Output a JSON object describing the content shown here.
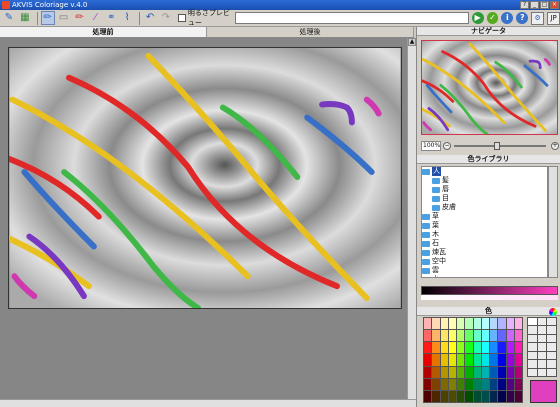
{
  "window": {
    "title": "AKVIS Coloriage v.4.0",
    "buttons": [
      "?",
      "_",
      "□",
      "×"
    ]
  },
  "toolbar": {
    "preview_label": "明るさプレビュー",
    "preview_checked": false,
    "url_value": "",
    "lang": "JP"
  },
  "tabs": [
    {
      "label": "処理前",
      "active": true
    },
    {
      "label": "処理後",
      "active": false
    }
  ],
  "navigator": {
    "title": "ナビゲータ",
    "zoom": "100%"
  },
  "library": {
    "title": "色ライブラリ",
    "items": [
      {
        "label": "人",
        "sub": false,
        "selected": true
      },
      {
        "label": "髪",
        "sub": true
      },
      {
        "label": "唇",
        "sub": true
      },
      {
        "label": "目",
        "sub": true
      },
      {
        "label": "皮膚",
        "sub": true
      },
      {
        "label": "草",
        "sub": false
      },
      {
        "label": "葉",
        "sub": false
      },
      {
        "label": "木",
        "sub": false
      },
      {
        "label": "石",
        "sub": false
      },
      {
        "label": "煉瓦",
        "sub": false
      },
      {
        "label": "空中",
        "sub": false
      },
      {
        "label": "雲",
        "sub": false
      },
      {
        "label": "水",
        "sub": false
      }
    ]
  },
  "color_panel": {
    "title": "色",
    "current_color": "#e040c0"
  },
  "strokes": [
    {
      "color": "#e8c020"
    },
    {
      "color": "#e8c020"
    },
    {
      "color": "#e8c020"
    },
    {
      "color": "#e02828"
    },
    {
      "color": "#e02828"
    },
    {
      "color": "#40b848"
    },
    {
      "color": "#40b848"
    },
    {
      "color": "#3870c8"
    },
    {
      "color": "#3870c8"
    },
    {
      "color": "#7838c0"
    },
    {
      "color": "#7838c0"
    },
    {
      "color": "#d038b0"
    },
    {
      "color": "#d038b0"
    }
  ]
}
